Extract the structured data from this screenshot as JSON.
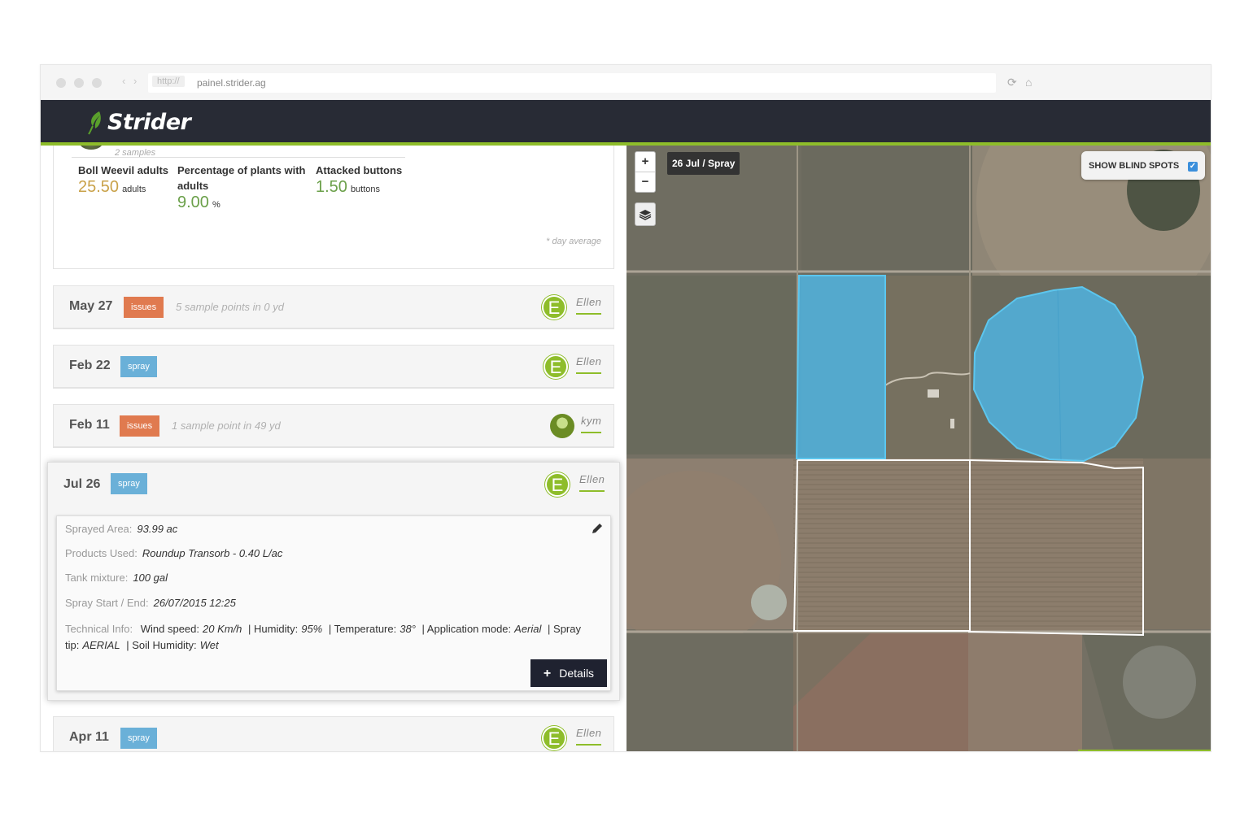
{
  "browser": {
    "protocol": "http://",
    "url": "painel.strider.ag"
  },
  "app": {
    "brand": "Strider"
  },
  "summary": {
    "samples": "2 samples",
    "metrics": [
      {
        "label": "Boll Weevil adults",
        "value": "25.50",
        "unit": "adults",
        "color": "#c9a24a"
      },
      {
        "label": "Percentage of plants with adults",
        "value": "9.00",
        "unit": "%",
        "color": "#6ba04a"
      },
      {
        "label": "Attacked buttons",
        "value": "1.50",
        "unit": "buttons",
        "color": "#6ba04a"
      }
    ],
    "note": "* day average"
  },
  "timeline": [
    {
      "date": "May 27",
      "badge": "issues",
      "hint": "5 sample points in 0 yd",
      "user_initial": "E",
      "user": "Ellen"
    },
    {
      "date": "Feb 22",
      "badge": "spray",
      "hint": "",
      "user_initial": "E",
      "user": "Ellen"
    },
    {
      "date": "Feb 11",
      "badge": "issues",
      "hint": "1 sample point in 49 yd",
      "user_initial": "",
      "user": "kym"
    },
    {
      "date": "Jul 26",
      "badge": "spray",
      "hint": "",
      "user_initial": "E",
      "user": "Ellen"
    },
    {
      "date": "Apr 11",
      "badge": "spray",
      "hint": "",
      "user_initial": "E",
      "user": "Ellen"
    }
  ],
  "detail": {
    "sprayed_area_label": "Sprayed Area:",
    "sprayed_area": "93.99 ac",
    "products_label": "Products Used:",
    "products": "Roundup Transorb - 0.40 L/ac",
    "tank_label": "Tank mixture:",
    "tank": "100 gal",
    "start_end_label": "Spray Start / End:",
    "start_end": "26/07/2015 12:25",
    "tech_label": "Technical Info:",
    "wind_label": "Wind speed:",
    "wind": "20 Km/h",
    "humidity_label": "| Humidity:",
    "humidity": "95%",
    "temp_label": "| Temperature:",
    "temp": "38°",
    "mode_label": "| Application mode:",
    "mode": "Aerial",
    "tip_label": "| Spray tip:",
    "tip": "AERIAL",
    "soil_label": "| Soil Humidity:",
    "soil": "Wet",
    "details_button": "Details"
  },
  "map": {
    "zoom_in": "+",
    "zoom_out": "−",
    "label": "26 Jul / Spray",
    "blind_spots": "SHOW BLIND SPOTS",
    "blind_spots_checked": true,
    "field_color": "#4fb3e0"
  }
}
